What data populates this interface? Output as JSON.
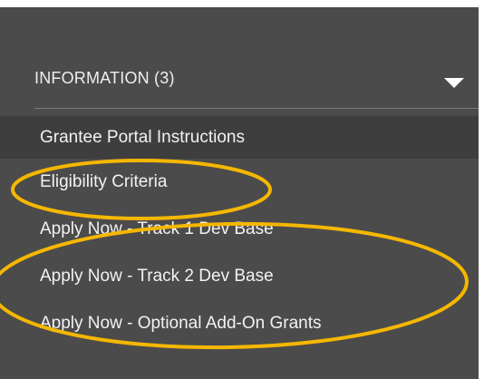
{
  "section": {
    "title": "INFORMATION (3)",
    "caret_icon": "caret-down-icon"
  },
  "menu": {
    "items": [
      {
        "label": "Grantee Portal Instructions",
        "active": true
      },
      {
        "label": "Eligibility Criteria",
        "active": false
      },
      {
        "label": "Apply Now - Track 1 Dev Base",
        "active": false
      },
      {
        "label": "Apply Now - Track 2 Dev Base",
        "active": false
      },
      {
        "label": "Apply Now - Optional Add-On Grants",
        "active": false
      }
    ]
  },
  "colors": {
    "panel_background": "#4b4b4b",
    "active_item_background": "#3e3e3e",
    "text": "#f2f2f2",
    "annotation_circle": "#f5b700"
  }
}
